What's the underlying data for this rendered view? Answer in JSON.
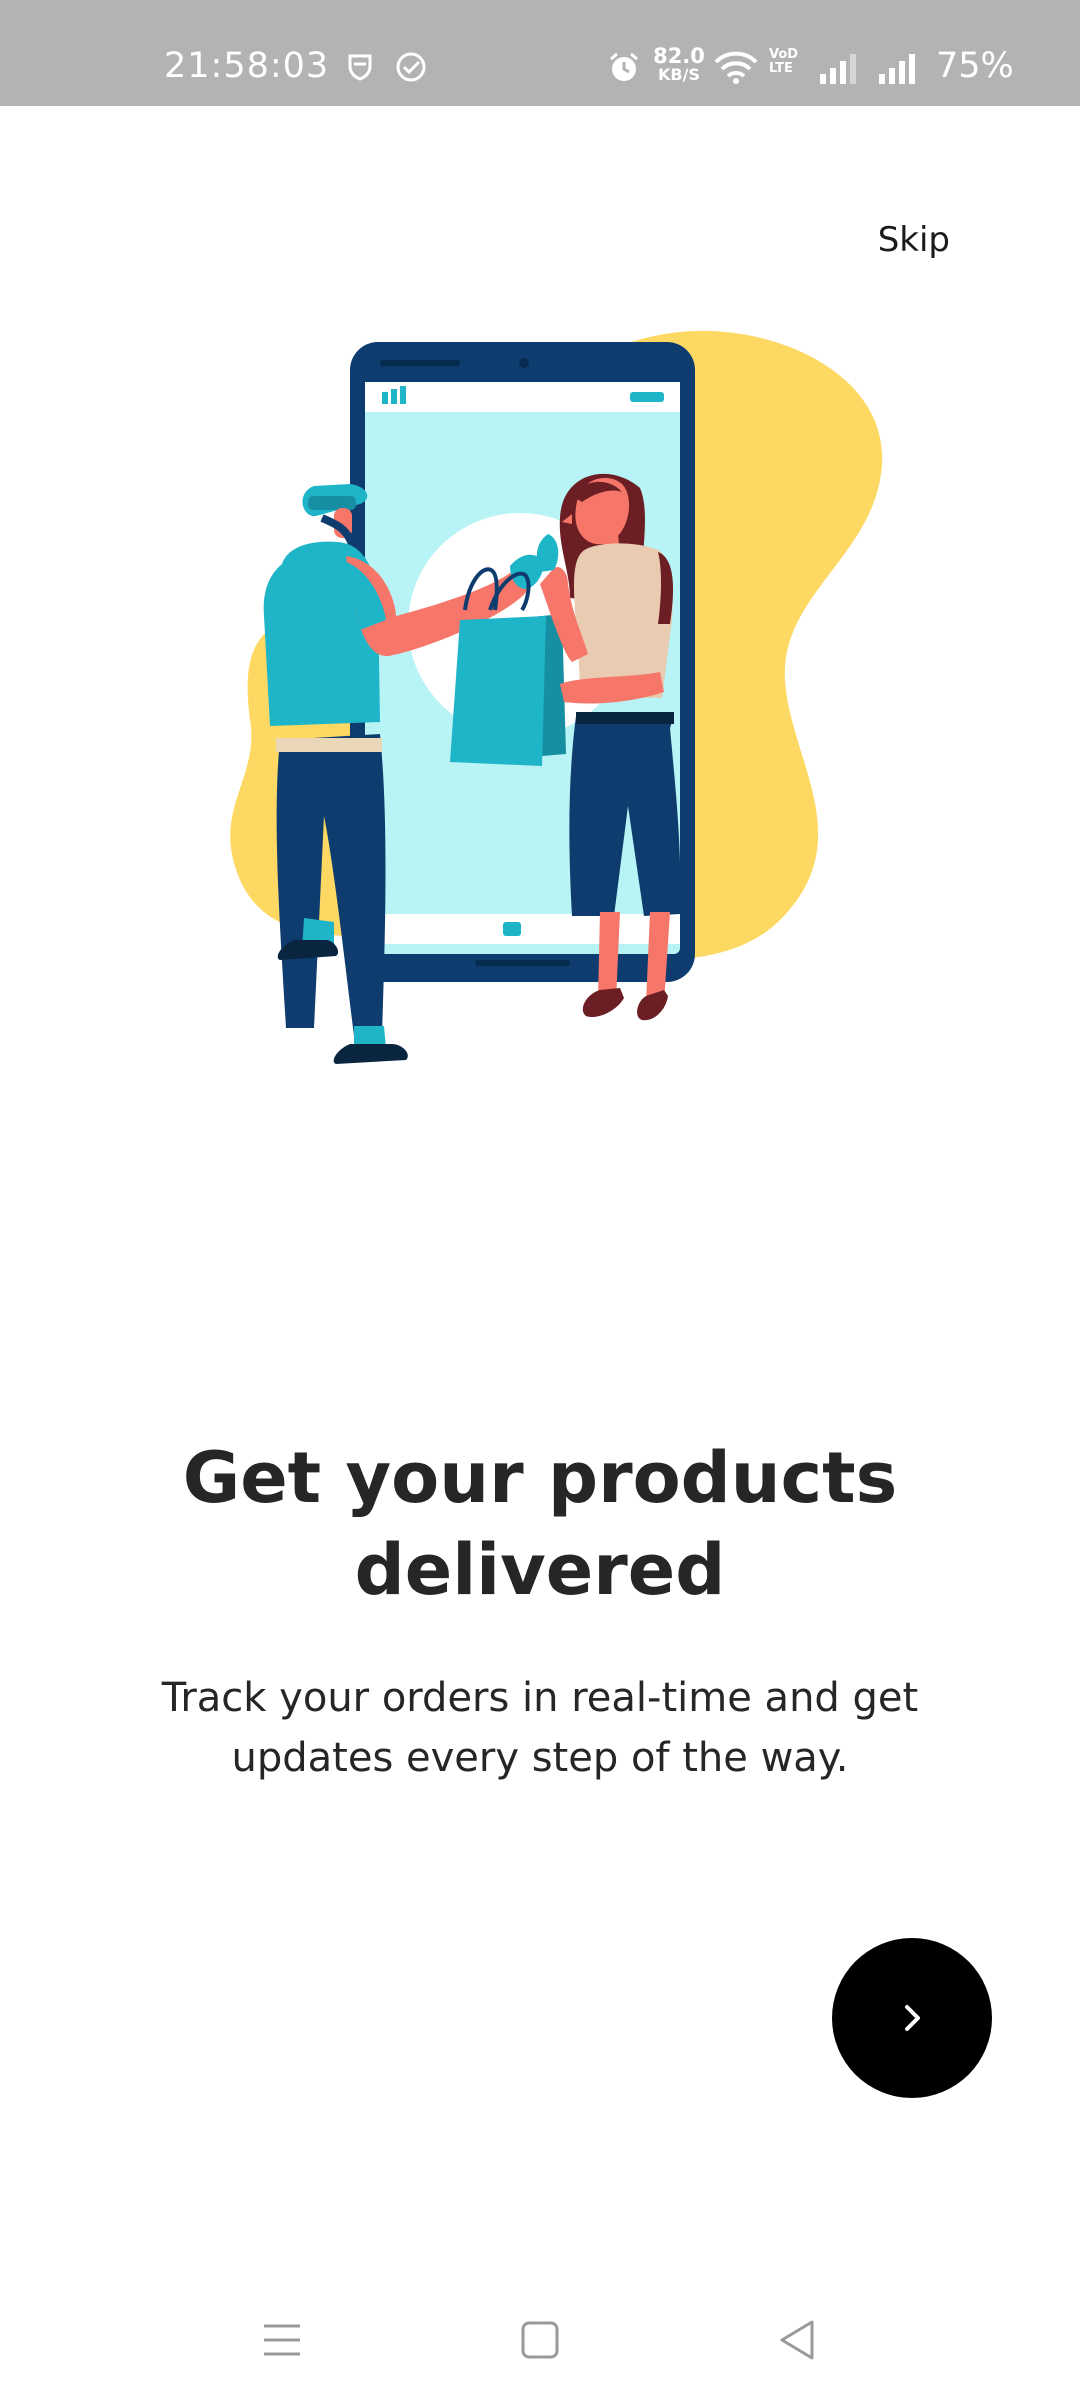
{
  "status_bar": {
    "time": "21:58:03",
    "net_speed_value": "82.0",
    "net_speed_unit": "KB/S",
    "volte_top": "VoD",
    "volte_bottom": "LTE",
    "battery": "75%",
    "icons": [
      "shield-icon",
      "check-circle-icon",
      "alarm-icon",
      "wifi-icon",
      "signal-icon",
      "signal-icon"
    ]
  },
  "onboarding": {
    "skip_label": "Skip",
    "title_line1": "Get your products",
    "title_line2": "delivered",
    "subtitle_line1": "Track your orders in real-time and get",
    "subtitle_line2": "updates every step of the way.",
    "next_icon": "chevron-right-icon"
  },
  "nav_bar": {
    "icons": [
      "menu-icon",
      "home-square-icon",
      "back-triangle-icon"
    ]
  },
  "colors": {
    "status_bar_bg": "#b3b3b3",
    "title_text": "#262626",
    "next_button": "#000000",
    "blob_yellow": "#fdd963",
    "phone_frame": "#0f3c6e",
    "screen_teal": "#b8f3f5",
    "accent_teal": "#1fb5c9"
  }
}
